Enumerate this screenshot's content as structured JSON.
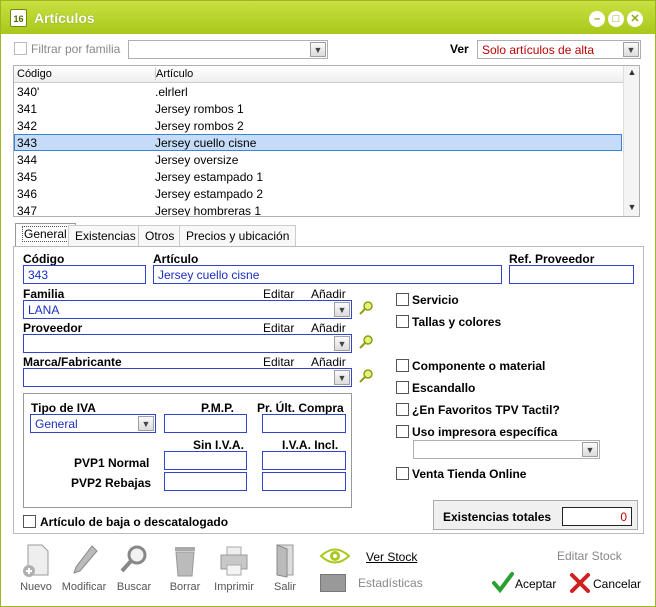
{
  "window": {
    "title": "Artículos",
    "icon_text": "16"
  },
  "filter": {
    "filtrar_label": "Filtrar por familia",
    "familia_value": "",
    "ver_label": "Ver",
    "ver_value": "Solo artículos de alta"
  },
  "list": {
    "headers": [
      "Código",
      "Artículo"
    ],
    "rows": [
      {
        "codigo": "340'",
        "articulo": ".elrlerl"
      },
      {
        "codigo": "341",
        "articulo": "Jersey rombos 1"
      },
      {
        "codigo": "342",
        "articulo": "Jersey rombos 2"
      },
      {
        "codigo": "343",
        "articulo": "Jersey cuello cisne"
      },
      {
        "codigo": "344",
        "articulo": "Jersey oversize"
      },
      {
        "codigo": "345",
        "articulo": "Jersey estampado 1"
      },
      {
        "codigo": "346",
        "articulo": "Jersey estampado 2"
      },
      {
        "codigo": "347",
        "articulo": "Jersey hombreras 1"
      }
    ]
  },
  "tabs": [
    "General",
    "Existencias",
    "Otros",
    "Precios y ubicación"
  ],
  "general": {
    "codigo_label": "Código",
    "codigo_value": "343",
    "articulo_label": "Artículo",
    "articulo_value": "Jersey cuello cisne",
    "ref_label": "Ref. Proveedor",
    "ref_value": "",
    "familia_label": "Familia",
    "familia_value": "LANA",
    "proveedor_label": "Proveedor",
    "proveedor_value": "",
    "marca_label": "Marca/Fabricante",
    "marca_value": "",
    "editar": "Editar",
    "anadir": "Añadir",
    "tipo_iva_label": "Tipo de IVA",
    "tipo_iva_value": "General",
    "pmp_label": "P.M.P.",
    "pr_ult_label": "Pr. Últ. Compra",
    "sin_iva_label": "Sin I.V.A.",
    "iva_incl_label": "I.V.A. Incl.",
    "pvp1_label": "PVP1 Normal",
    "pvp2_label": "PVP2 Rebajas",
    "baja_label": "Artículo de baja o descatalogado",
    "servicio": "Servicio",
    "tallas": "Tallas y colores",
    "componente": "Componente o material",
    "escandallo": "Escandallo",
    "favoritos": "¿En Favoritos TPV Tactil?",
    "uso_impresora": "Uso impresora específica",
    "venta_online": "Venta Tienda Online",
    "existencias_label": "Existencias totales",
    "existencias_value": "0"
  },
  "toolbar": {
    "nuevo": "Nuevo",
    "modificar": "Modificar",
    "buscar": "Buscar",
    "borrar": "Borrar",
    "imprimir": "Imprimir",
    "salir": "Salir",
    "ver_stock": "Ver Stock",
    "estadisticas": "Estadísticas",
    "editar_stock": "Editar Stock",
    "aceptar": "Aceptar",
    "cancelar": "Cancelar"
  },
  "colors": {
    "accent": "#b4d22a",
    "field_border": "#3344cc",
    "selection": "#c4dcf8"
  }
}
